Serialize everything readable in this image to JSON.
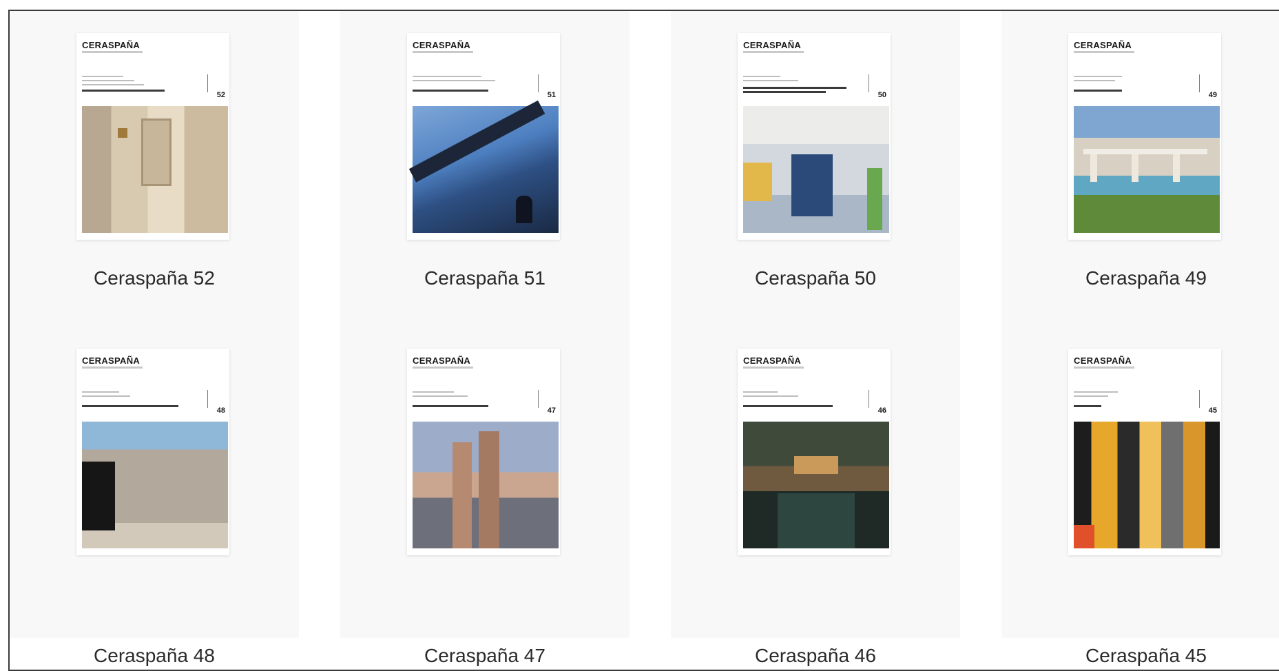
{
  "magazines": [
    {
      "title": "Ceraspaña 52",
      "brand": "CERASPAÑA",
      "issue": "52"
    },
    {
      "title": "Ceraspaña 51",
      "brand": "CERASPAÑA",
      "issue": "51"
    },
    {
      "title": "Ceraspaña 50",
      "brand": "CERASPAÑA",
      "issue": "50"
    },
    {
      "title": "Ceraspaña 49",
      "brand": "CERASPAÑA",
      "issue": "49"
    },
    {
      "title": "Ceraspaña 48",
      "brand": "CERASPAÑA",
      "issue": "48"
    },
    {
      "title": "Ceraspaña 47",
      "brand": "CERASPAÑA",
      "issue": "47"
    },
    {
      "title": "Ceraspaña 46",
      "brand": "CERASPAÑA",
      "issue": "46"
    },
    {
      "title": "Ceraspaña 45",
      "brand": "CERASPAÑA",
      "issue": "45"
    }
  ]
}
